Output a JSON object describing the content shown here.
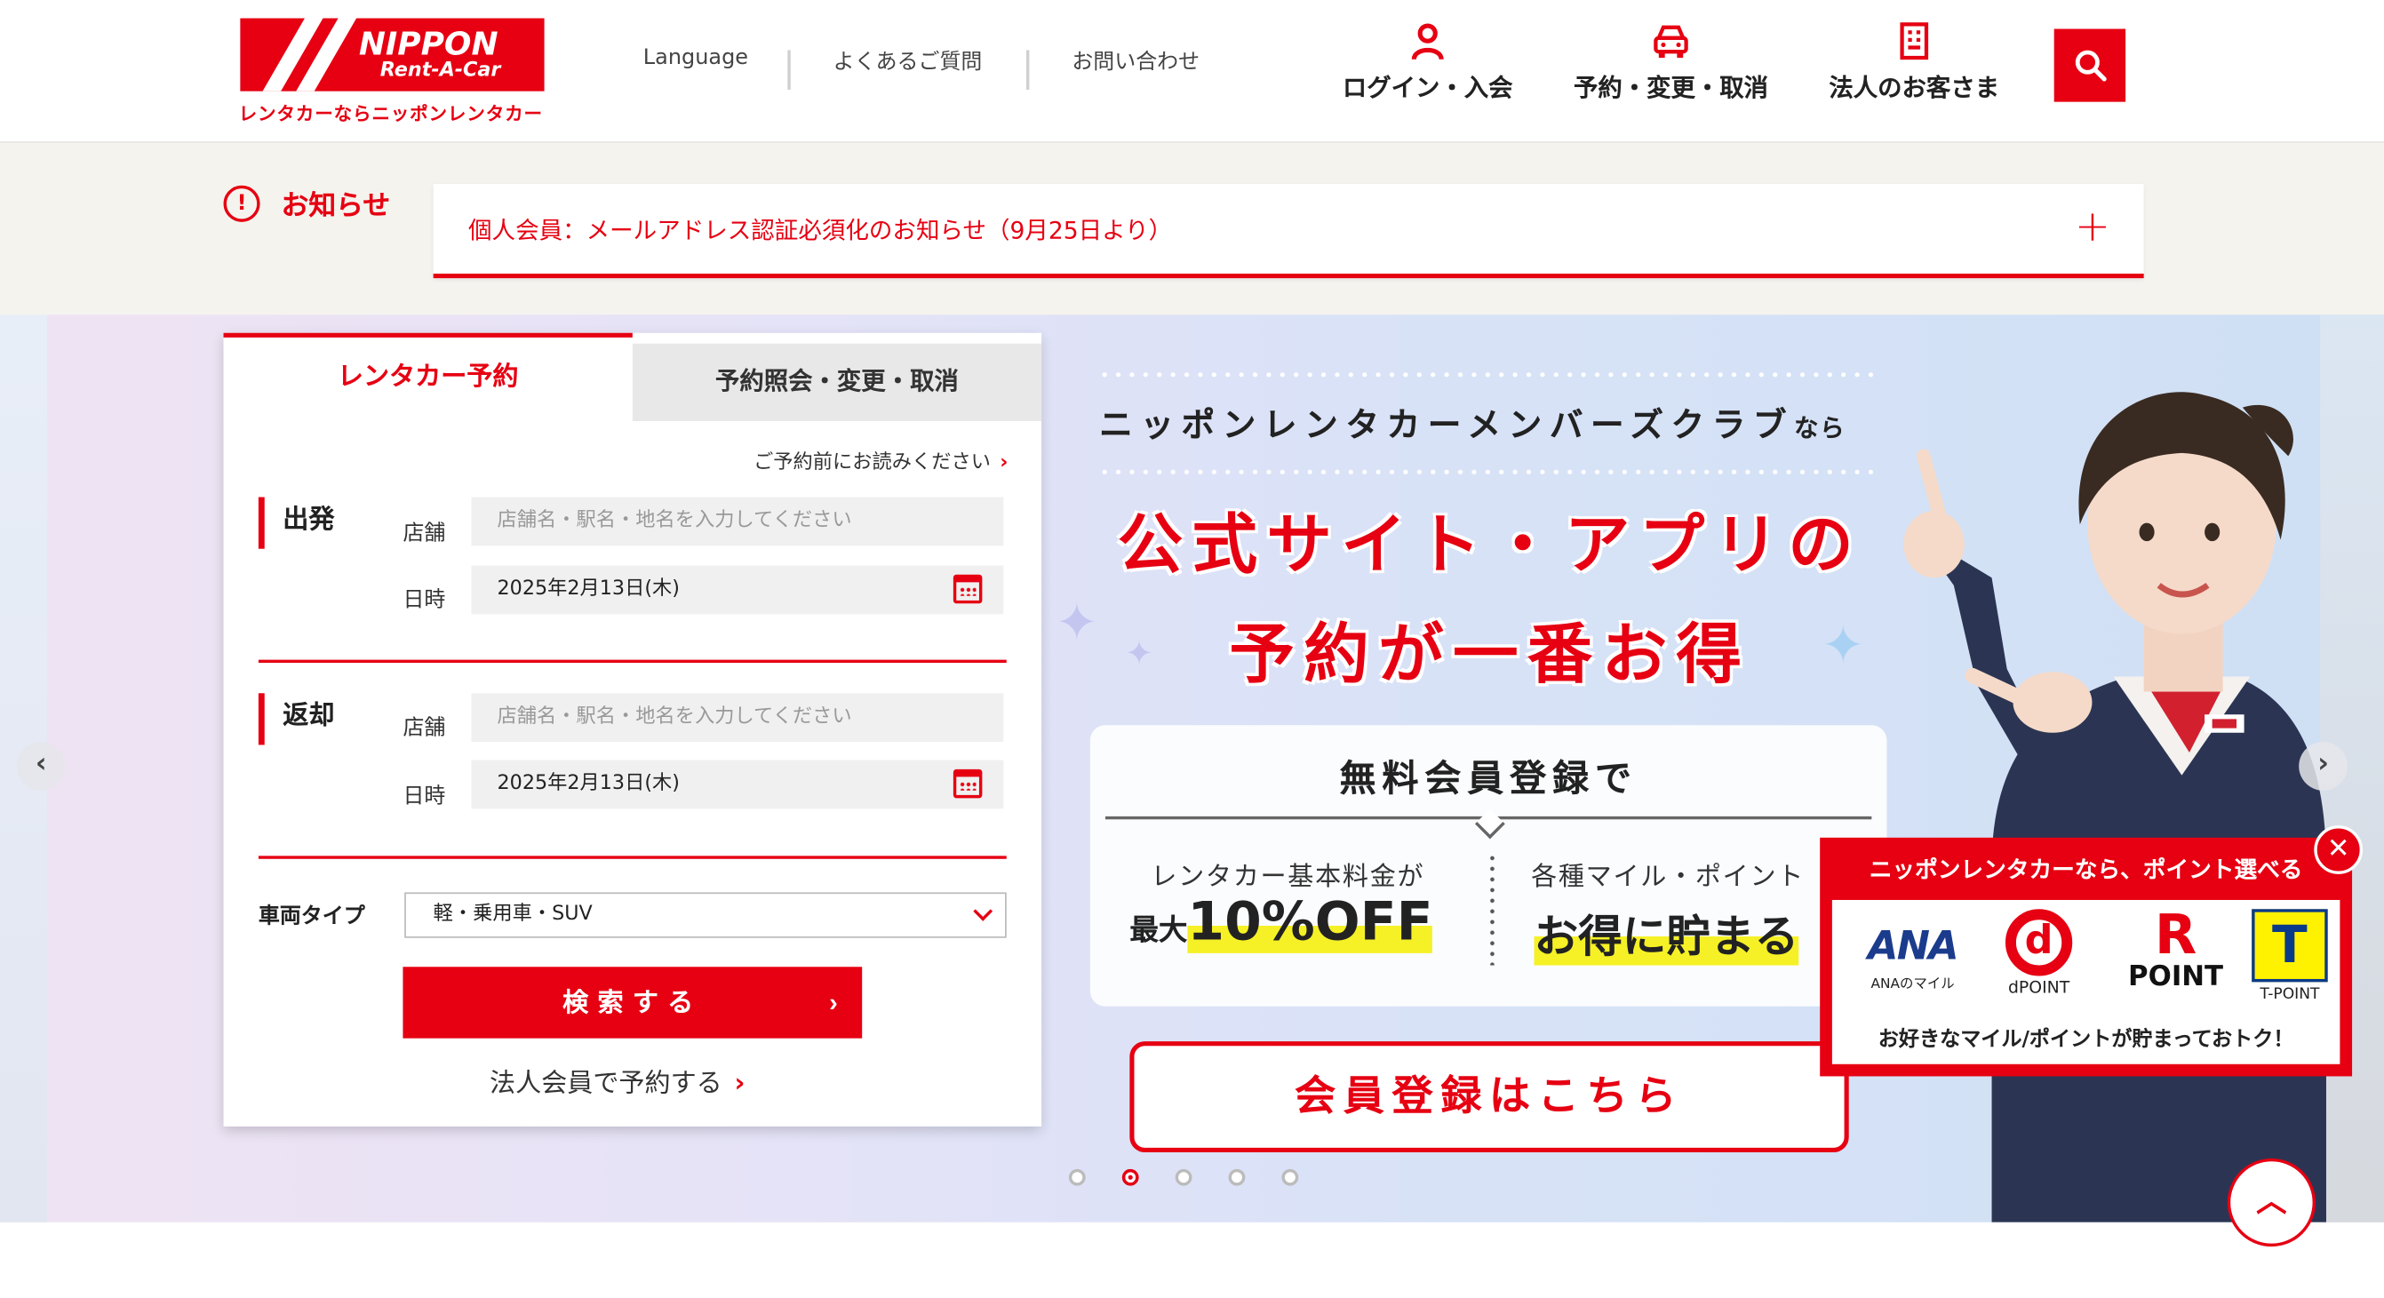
{
  "header": {
    "logo_brand": "NIPPON",
    "logo_sub": "Rent-A-Car",
    "tagline": "レンタカーならニッポンレンタカー",
    "language": "Language",
    "faq": "よくあるご質問",
    "contact": "お問い合わせ",
    "login": "ログイン・入会",
    "reserve": "予約・変更・取消",
    "corporate": "法人のお客さま",
    "icons": {
      "login": "person-icon",
      "reserve": "car-icon",
      "corporate": "building-icon",
      "search": "search-icon"
    }
  },
  "notice": {
    "title": "お知らせ",
    "message": "個人会員：メールアドレス認証必須化のお知らせ（9月25日より）",
    "expand": "+"
  },
  "reservation": {
    "tab_active": "レンタカー予約",
    "tab_inactive": "予約照会・変更・取消",
    "pre_read": "ご予約前にお読みください",
    "departure": {
      "label": "出発",
      "store_label": "店舗",
      "store_placeholder": "店舗名・駅名・地名を入力してください",
      "date_label": "日時",
      "date_value": "2025年2月13日(木)"
    },
    "return": {
      "label": "返却",
      "store_label": "店舗",
      "store_placeholder": "店舗名・駅名・地名を入力してください",
      "date_label": "日時",
      "date_value": "2025年2月13日(木)"
    },
    "vehicle_type_label": "車両タイプ",
    "vehicle_type_value": "軽・乗用車・SUV",
    "search_button": "検索する",
    "corporate_link": "法人会員で予約する"
  },
  "banner": {
    "subtitle": "ニッポンレンタカーメンバーズクラブ",
    "subtitle_suffix": "なら",
    "headline_1": "公式サイト・アプリの",
    "headline_2": "予約が一番お得",
    "benefit_title": "無料会員登録で",
    "benefit1_label": "レンタカー基本料金が",
    "benefit1_prefix": "最大",
    "benefit1_value": "10%OFF",
    "benefit2_label": "各種マイル・ポイント",
    "benefit2_value": "お得に貯まる",
    "register_button": "会員登録はこちら"
  },
  "carousel": {
    "slide_count": 5,
    "active_index": 1
  },
  "points_popup": {
    "title": "ニッポンレンタカーなら、ポイント選べる",
    "ana_mark": "ANA",
    "ana_caption": "ANAのマイル",
    "d_mark": "d",
    "d_caption": "dPOINT",
    "r_mark": "R",
    "r_caption": "POINT",
    "t_mark": "T",
    "t_caption": "T-POINT",
    "footer": "お好きなマイル/ポイントが貯まっておトク！"
  },
  "colors": {
    "brand_red": "#e60012",
    "highlight_yellow": "#f5f126"
  }
}
